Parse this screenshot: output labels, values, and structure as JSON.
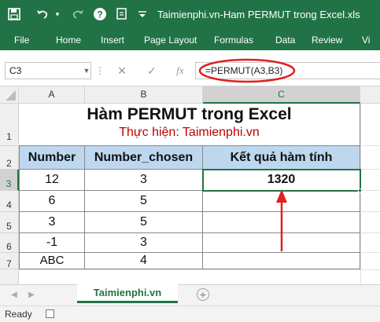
{
  "window": {
    "title": "Taimienphi.vn-Ham PERMUT trong Excel.xls"
  },
  "quick_access": {
    "icons": [
      "save-icon",
      "undo-icon",
      "redo-icon",
      "help-icon",
      "touch-mode-icon"
    ]
  },
  "ribbon": {
    "tabs": [
      "File",
      "Home",
      "Insert",
      "Page Layout",
      "Formulas",
      "Data",
      "Review",
      "Vi"
    ]
  },
  "formula_bar": {
    "name_box": "C3",
    "cancel_symbol": "✕",
    "enter_symbol": "✓",
    "fx_symbol": "fx",
    "formula": "=PERMUT(A3,B3)"
  },
  "columns": [
    "A",
    "B",
    "C"
  ],
  "rows": [
    "1",
    "2",
    "3",
    "4",
    "5",
    "6",
    "7"
  ],
  "sheet": {
    "title": "Hàm PERMUT trong Excel",
    "subtitle": "Thực hiện: Taimienphi.vn",
    "headers": [
      "Number",
      "Number_chosen",
      "Kết quả hàm tính"
    ],
    "data": [
      [
        "12",
        "3",
        "1320"
      ],
      [
        "6",
        "5",
        ""
      ],
      [
        "3",
        "5",
        ""
      ],
      [
        "-1",
        "3",
        ""
      ],
      [
        "ABC",
        "4",
        ""
      ]
    ]
  },
  "sheet_tabs": {
    "active": "Taimienphi.vn",
    "add_symbol": "+"
  },
  "status": {
    "text": "Ready"
  },
  "colors": {
    "excel_green": "#217346",
    "header_fill": "#bdd7ee",
    "subtitle_red": "#c00000",
    "annotation_red": "#e02020"
  }
}
